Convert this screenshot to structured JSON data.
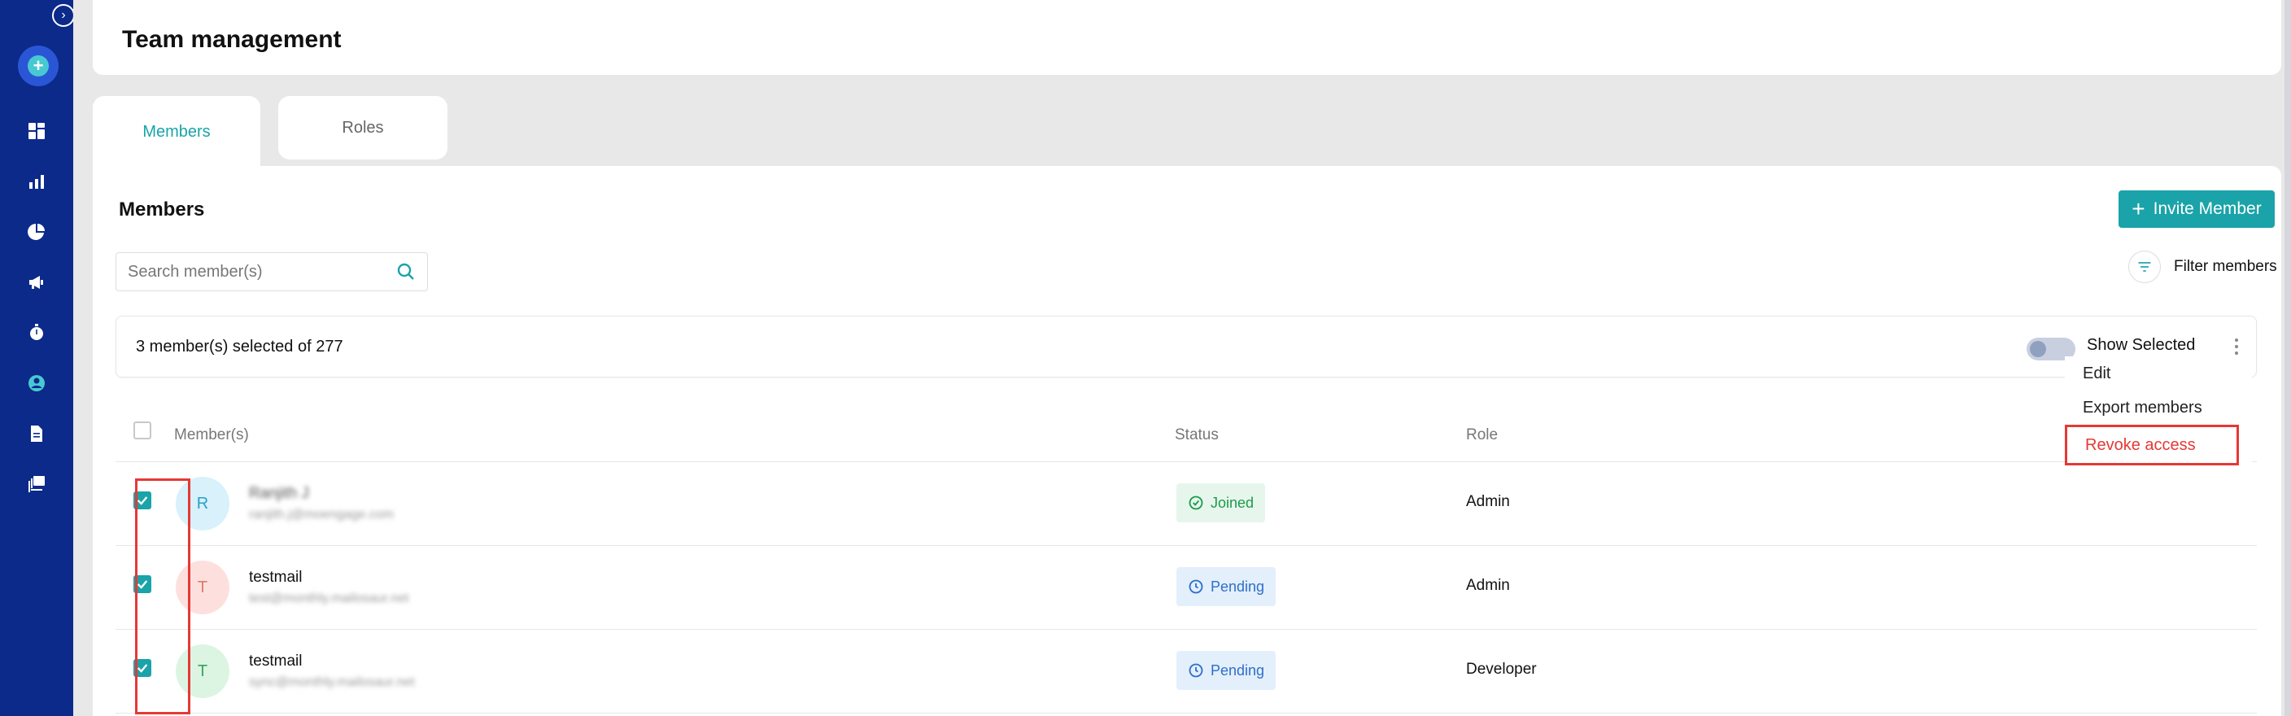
{
  "sidebar": {
    "items": [
      {
        "icon": "dashboard-icon"
      },
      {
        "icon": "bar-chart-icon"
      },
      {
        "icon": "pie-chart-icon"
      },
      {
        "icon": "megaphone-icon"
      },
      {
        "icon": "timer-icon"
      },
      {
        "icon": "user-circle-icon"
      },
      {
        "icon": "document-icon"
      },
      {
        "icon": "gallery-icon"
      }
    ]
  },
  "header": {
    "title": "Team management"
  },
  "tabs": [
    {
      "label": "Members",
      "active": true
    },
    {
      "label": "Roles",
      "active": false
    }
  ],
  "members_panel": {
    "title": "Members",
    "invite_label": "Invite Member",
    "search_placeholder": "Search member(s)",
    "filter_label": "Filter members",
    "selection_text": "3 member(s) selected of 277",
    "show_selected_label": "Show Selected"
  },
  "dropdown": {
    "items": [
      "Edit",
      "Export members",
      "Revoke access"
    ]
  },
  "table": {
    "headers": {
      "member": "Member(s)",
      "status": "Status",
      "role": "Role"
    },
    "rows": [
      {
        "initial": "R",
        "name": "Ranjith J",
        "email": "ranjith.j@moengage.com",
        "status": "Joined",
        "role": "Admin"
      },
      {
        "initial": "T",
        "name": "testmail",
        "email": "test@monthly.mailosaur.net",
        "status": "Pending",
        "role": "Admin"
      },
      {
        "initial": "T",
        "name": "testmail",
        "email": "sync@monthly.mailosaur.net",
        "status": "Pending",
        "role": "Developer"
      }
    ]
  },
  "colors": {
    "sidebar": "#0b2a8a",
    "accent": "#1aa3a8",
    "danger": "#e53935"
  }
}
